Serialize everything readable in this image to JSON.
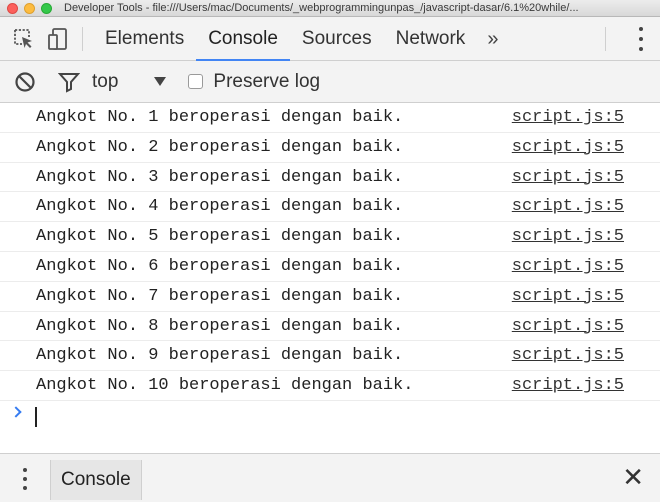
{
  "window": {
    "title": "Developer Tools - file:///Users/mac/Documents/_webprogrammingunpas_/javascript-dasar/6.1%20while/..."
  },
  "tabs": [
    {
      "label": "Elements"
    },
    {
      "label": "Console"
    },
    {
      "label": "Sources"
    },
    {
      "label": "Network"
    }
  ],
  "tabs_active": "Console",
  "tabs_more": "»",
  "filter": {
    "context": "top",
    "preserve_log_label": "Preserve log",
    "preserve_log_checked": false
  },
  "console": {
    "messages": [
      {
        "text": "Angkot No. 1 beroperasi dengan baik.",
        "source": "script.js:5"
      },
      {
        "text": "Angkot No. 2 beroperasi dengan baik.",
        "source": "script.js:5"
      },
      {
        "text": "Angkot No. 3 beroperasi dengan baik.",
        "source": "script.js:5"
      },
      {
        "text": "Angkot No. 4 beroperasi dengan baik.",
        "source": "script.js:5"
      },
      {
        "text": "Angkot No. 5 beroperasi dengan baik.",
        "source": "script.js:5"
      },
      {
        "text": "Angkot No. 6 beroperasi dengan baik.",
        "source": "script.js:5"
      },
      {
        "text": "Angkot No. 7 beroperasi dengan baik.",
        "source": "script.js:5"
      },
      {
        "text": "Angkot No. 8 beroperasi dengan baik.",
        "source": "script.js:5"
      },
      {
        "text": "Angkot No. 9 beroperasi dengan baik.",
        "source": "script.js:5"
      },
      {
        "text": "Angkot No. 10 beroperasi dengan baik.",
        "source": "script.js:5"
      }
    ],
    "prompt_value": ""
  },
  "drawer": {
    "tab_label": "Console",
    "close_glyph": "✕"
  },
  "colors": {
    "accent": "#4285f4",
    "prompt": "#367cf1"
  }
}
